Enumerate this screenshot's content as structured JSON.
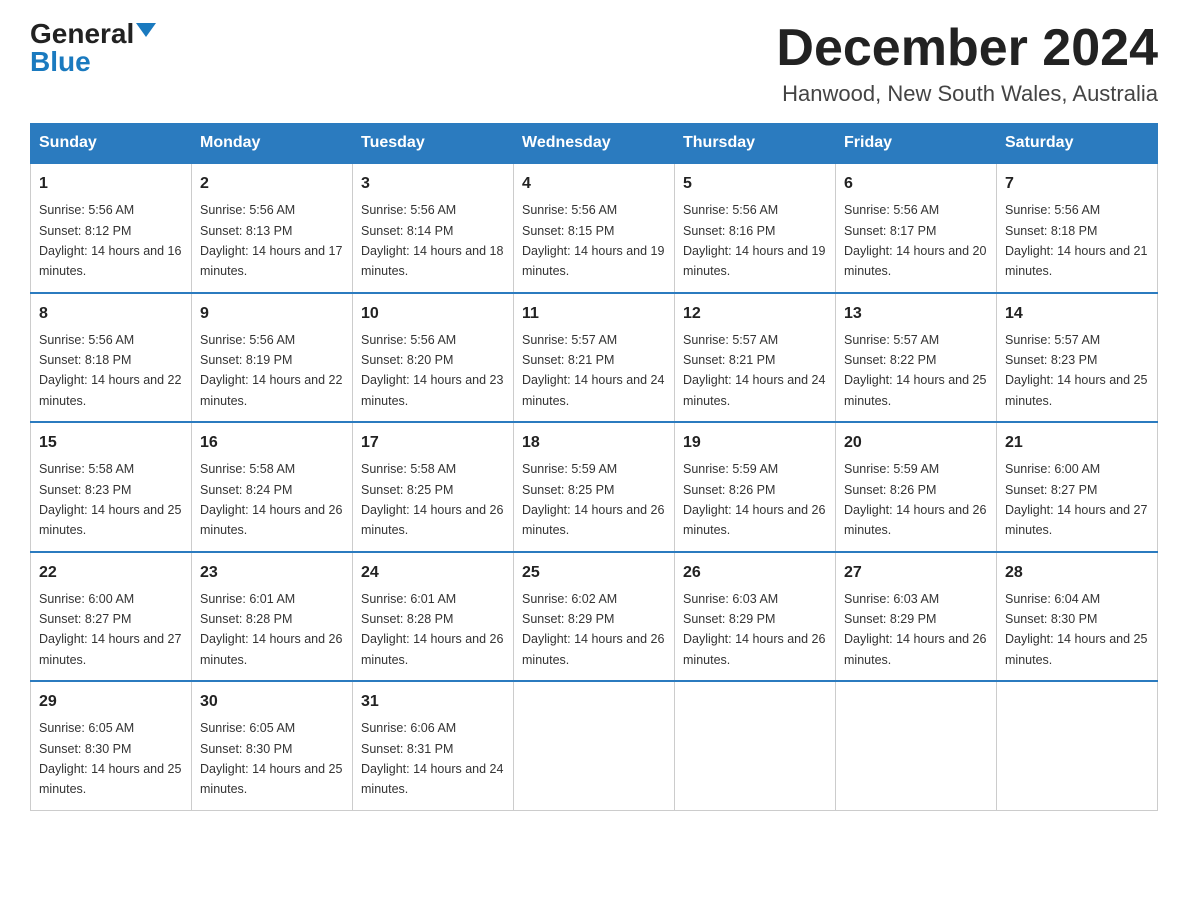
{
  "header": {
    "logo_general": "General",
    "logo_blue": "Blue",
    "month_year": "December 2024",
    "location": "Hanwood, New South Wales, Australia"
  },
  "days_of_week": [
    "Sunday",
    "Monday",
    "Tuesday",
    "Wednesday",
    "Thursday",
    "Friday",
    "Saturday"
  ],
  "weeks": [
    [
      {
        "num": "1",
        "sunrise": "5:56 AM",
        "sunset": "8:12 PM",
        "daylight": "14 hours and 16 minutes."
      },
      {
        "num": "2",
        "sunrise": "5:56 AM",
        "sunset": "8:13 PM",
        "daylight": "14 hours and 17 minutes."
      },
      {
        "num": "3",
        "sunrise": "5:56 AM",
        "sunset": "8:14 PM",
        "daylight": "14 hours and 18 minutes."
      },
      {
        "num": "4",
        "sunrise": "5:56 AM",
        "sunset": "8:15 PM",
        "daylight": "14 hours and 19 minutes."
      },
      {
        "num": "5",
        "sunrise": "5:56 AM",
        "sunset": "8:16 PM",
        "daylight": "14 hours and 19 minutes."
      },
      {
        "num": "6",
        "sunrise": "5:56 AM",
        "sunset": "8:17 PM",
        "daylight": "14 hours and 20 minutes."
      },
      {
        "num": "7",
        "sunrise": "5:56 AM",
        "sunset": "8:18 PM",
        "daylight": "14 hours and 21 minutes."
      }
    ],
    [
      {
        "num": "8",
        "sunrise": "5:56 AM",
        "sunset": "8:18 PM",
        "daylight": "14 hours and 22 minutes."
      },
      {
        "num": "9",
        "sunrise": "5:56 AM",
        "sunset": "8:19 PM",
        "daylight": "14 hours and 22 minutes."
      },
      {
        "num": "10",
        "sunrise": "5:56 AM",
        "sunset": "8:20 PM",
        "daylight": "14 hours and 23 minutes."
      },
      {
        "num": "11",
        "sunrise": "5:57 AM",
        "sunset": "8:21 PM",
        "daylight": "14 hours and 24 minutes."
      },
      {
        "num": "12",
        "sunrise": "5:57 AM",
        "sunset": "8:21 PM",
        "daylight": "14 hours and 24 minutes."
      },
      {
        "num": "13",
        "sunrise": "5:57 AM",
        "sunset": "8:22 PM",
        "daylight": "14 hours and 25 minutes."
      },
      {
        "num": "14",
        "sunrise": "5:57 AM",
        "sunset": "8:23 PM",
        "daylight": "14 hours and 25 minutes."
      }
    ],
    [
      {
        "num": "15",
        "sunrise": "5:58 AM",
        "sunset": "8:23 PM",
        "daylight": "14 hours and 25 minutes."
      },
      {
        "num": "16",
        "sunrise": "5:58 AM",
        "sunset": "8:24 PM",
        "daylight": "14 hours and 26 minutes."
      },
      {
        "num": "17",
        "sunrise": "5:58 AM",
        "sunset": "8:25 PM",
        "daylight": "14 hours and 26 minutes."
      },
      {
        "num": "18",
        "sunrise": "5:59 AM",
        "sunset": "8:25 PM",
        "daylight": "14 hours and 26 minutes."
      },
      {
        "num": "19",
        "sunrise": "5:59 AM",
        "sunset": "8:26 PM",
        "daylight": "14 hours and 26 minutes."
      },
      {
        "num": "20",
        "sunrise": "5:59 AM",
        "sunset": "8:26 PM",
        "daylight": "14 hours and 26 minutes."
      },
      {
        "num": "21",
        "sunrise": "6:00 AM",
        "sunset": "8:27 PM",
        "daylight": "14 hours and 27 minutes."
      }
    ],
    [
      {
        "num": "22",
        "sunrise": "6:00 AM",
        "sunset": "8:27 PM",
        "daylight": "14 hours and 27 minutes."
      },
      {
        "num": "23",
        "sunrise": "6:01 AM",
        "sunset": "8:28 PM",
        "daylight": "14 hours and 26 minutes."
      },
      {
        "num": "24",
        "sunrise": "6:01 AM",
        "sunset": "8:28 PM",
        "daylight": "14 hours and 26 minutes."
      },
      {
        "num": "25",
        "sunrise": "6:02 AM",
        "sunset": "8:29 PM",
        "daylight": "14 hours and 26 minutes."
      },
      {
        "num": "26",
        "sunrise": "6:03 AM",
        "sunset": "8:29 PM",
        "daylight": "14 hours and 26 minutes."
      },
      {
        "num": "27",
        "sunrise": "6:03 AM",
        "sunset": "8:29 PM",
        "daylight": "14 hours and 26 minutes."
      },
      {
        "num": "28",
        "sunrise": "6:04 AM",
        "sunset": "8:30 PM",
        "daylight": "14 hours and 25 minutes."
      }
    ],
    [
      {
        "num": "29",
        "sunrise": "6:05 AM",
        "sunset": "8:30 PM",
        "daylight": "14 hours and 25 minutes."
      },
      {
        "num": "30",
        "sunrise": "6:05 AM",
        "sunset": "8:30 PM",
        "daylight": "14 hours and 25 minutes."
      },
      {
        "num": "31",
        "sunrise": "6:06 AM",
        "sunset": "8:31 PM",
        "daylight": "14 hours and 24 minutes."
      },
      null,
      null,
      null,
      null
    ]
  ]
}
